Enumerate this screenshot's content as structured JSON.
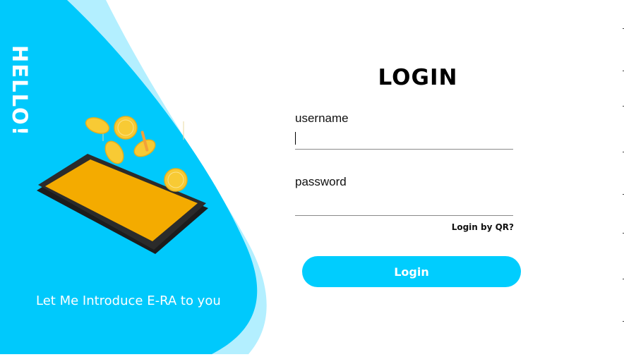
{
  "left_panel": {
    "hello_text": "HELLO!",
    "tagline": "Let Me Introduce E-RA to you",
    "illustration": "phone-with-coins"
  },
  "login": {
    "title": "LOGIN",
    "username_label": "username",
    "username_value": "",
    "password_label": "password",
    "password_value": "",
    "qr_link": "Login by QR?",
    "submit_label": "Login"
  },
  "colors": {
    "primary_blue": "#00cdfe",
    "light_blue": "#b3efff",
    "phone_screen": "#f4ab00",
    "coin": "#f8ca34",
    "text_dark": "#111111"
  }
}
